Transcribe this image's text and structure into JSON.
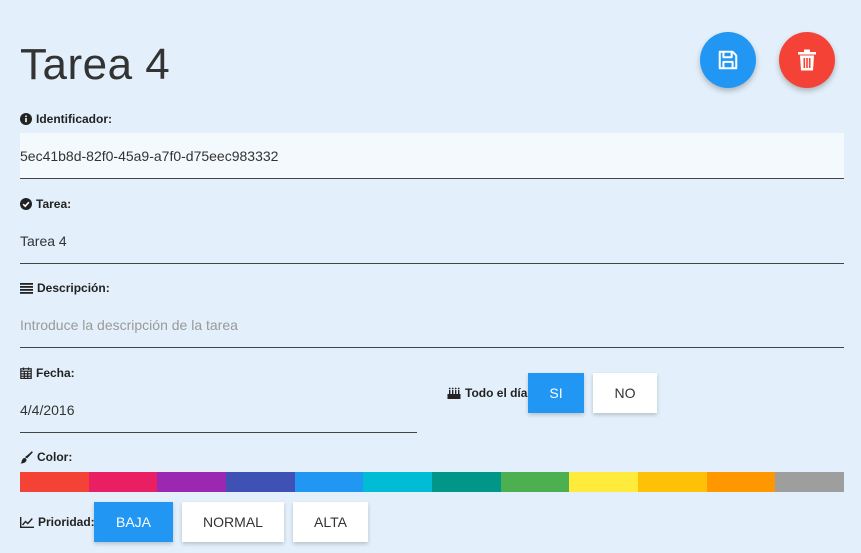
{
  "title": "Tarea 4",
  "actions": {
    "save_icon": "floppy-disk-icon",
    "delete_icon": "trash-icon"
  },
  "identificador": {
    "label": "Identificador:",
    "value": "5ec41b8d-82f0-45a9-a7f0-d75eec983332",
    "icon": "info-circle-icon"
  },
  "tarea": {
    "label": "Tarea:",
    "value": "Tarea 4",
    "icon": "check-circle-icon"
  },
  "descripcion": {
    "label": "Descripción:",
    "placeholder": "Introduce la descripción de la tarea",
    "value": "",
    "icon": "align-justify-icon"
  },
  "fecha": {
    "label": "Fecha:",
    "value": "4/4/2016",
    "icon": "calendar-icon"
  },
  "todo_el_dia": {
    "label": "Todo el día:",
    "icon": "birthday-cake-icon",
    "options": [
      "SI",
      "NO"
    ],
    "selected": "SI"
  },
  "color": {
    "label": "Color:",
    "icon": "paint-brush-icon",
    "swatches": [
      "#f44336",
      "#e91e63",
      "#9c27b0",
      "#3f51b5",
      "#2196f3",
      "#00bcd4",
      "#009688",
      "#4caf50",
      "#ffeb3b",
      "#ffc107",
      "#ff9800",
      "#9e9e9e"
    ]
  },
  "prioridad": {
    "label": "Prioridad:",
    "icon": "line-chart-icon",
    "options": [
      "BAJA",
      "NORMAL",
      "ALTA"
    ],
    "selected": "BAJA"
  },
  "accent": "#2196f3",
  "danger": "#f44336"
}
